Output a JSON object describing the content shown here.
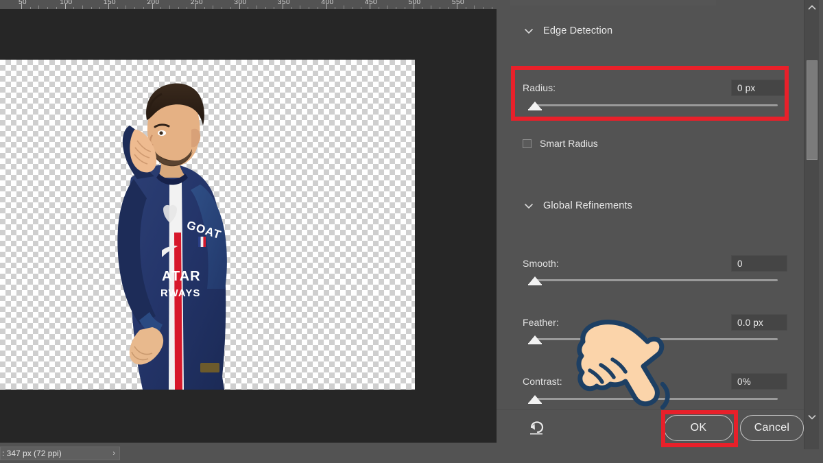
{
  "document": {
    "ruler": {
      "unit_labels": [
        "50",
        "100",
        "150",
        "200",
        "250",
        "300",
        "350",
        "400",
        "450",
        "500",
        "550"
      ],
      "orientation": "horizontal"
    },
    "statusbar": {
      "text": ": 347 px (72 ppi)",
      "expander_glyph": "›"
    },
    "canvas": {
      "background": "transparent-checkerboard",
      "artwork_alt": "soccer-player-cutout"
    }
  },
  "panel": {
    "sections": [
      {
        "id": "edge-detection",
        "title": "Edge Detection",
        "twisty_glyph": "⌄",
        "expanded": true
      },
      {
        "id": "global-refinements",
        "title": "Global Refinements",
        "twisty_glyph": "⌄",
        "expanded": true
      }
    ],
    "edge_detection": {
      "radius": {
        "label": "Radius:",
        "value": "0 px",
        "slider_position_pct": 0,
        "highlighted": true
      },
      "smart_radius": {
        "label": "Smart Radius",
        "checked": false
      }
    },
    "global_refinements": {
      "smooth": {
        "label": "Smooth:",
        "value": "0",
        "slider_position_pct": 0
      },
      "feather": {
        "label": "Feather:",
        "value": "0.0 px",
        "slider_position_pct": 0
      },
      "contrast": {
        "label": "Contrast:",
        "value": "0%",
        "slider_position_pct": 0
      }
    },
    "footer": {
      "reset_icon": "reset-undo-icon",
      "ok_label": "OK",
      "cancel_label": "Cancel",
      "ok_highlighted": true
    },
    "scrollbar": {
      "up_glyph": "⌃",
      "down_glyph": "⌄"
    }
  },
  "overlay": {
    "cursor": "pointing-hand-cursor",
    "highlight_color": "#e8202a",
    "highlights": [
      {
        "target": "radius-row"
      },
      {
        "target": "ok-button"
      }
    ]
  },
  "colors": {
    "panel_bg": "#535353",
    "canvas_bg": "#262626",
    "input_bg": "#454545",
    "slider_track": "#9a9a9a",
    "accent_highlight": "#e8202a",
    "cursor_fill": "#fbd4aa",
    "cursor_outline": "#1d3f63"
  }
}
